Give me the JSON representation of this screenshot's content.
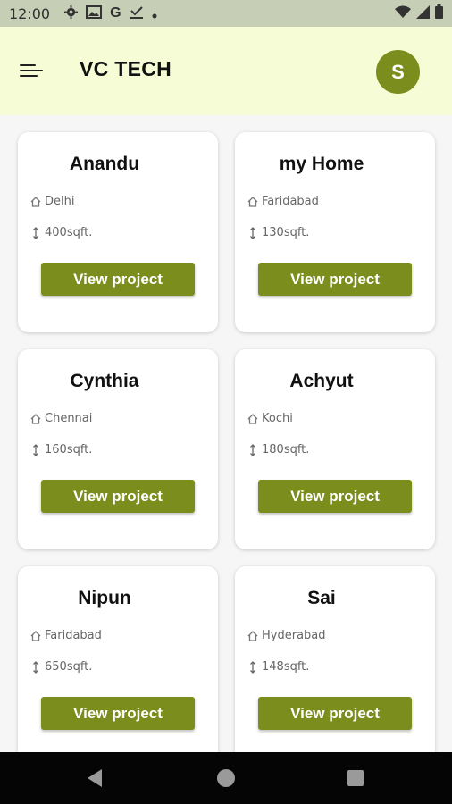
{
  "status_bar": {
    "time": "12:00",
    "icons": [
      "settings-icon",
      "image-icon",
      "google-icon",
      "checkbox-icon",
      "dot-icon"
    ],
    "google_letter": "G",
    "right_icons": [
      "wifi-icon",
      "signal-icon",
      "battery-icon"
    ]
  },
  "app_bar": {
    "title": "VC TECH",
    "avatar_letter": "S"
  },
  "colors": {
    "accent": "#7b8d1c",
    "app_bar_bg": "#f6fdd6",
    "status_bar_bg": "#c7ceb6"
  },
  "projects": [
    {
      "name": "Anandu",
      "location": "Delhi",
      "area": "400sqft.",
      "button": "View project"
    },
    {
      "name": "my Home",
      "location": "Faridabad",
      "area": "130sqft.",
      "button": "View project"
    },
    {
      "name": "Cynthia",
      "location": "Chennai",
      "area": "160sqft.",
      "button": "View project"
    },
    {
      "name": "Achyut",
      "location": "Kochi",
      "area": "180sqft.",
      "button": "View project"
    },
    {
      "name": "Nipun",
      "location": "Faridabad",
      "area": "650sqft.",
      "button": "View project"
    },
    {
      "name": "Sai",
      "location": "Hyderabad",
      "area": "148sqft.",
      "button": "View project"
    }
  ],
  "nav_bar": {
    "icons": [
      "back-icon",
      "home-icon",
      "recents-icon"
    ]
  }
}
